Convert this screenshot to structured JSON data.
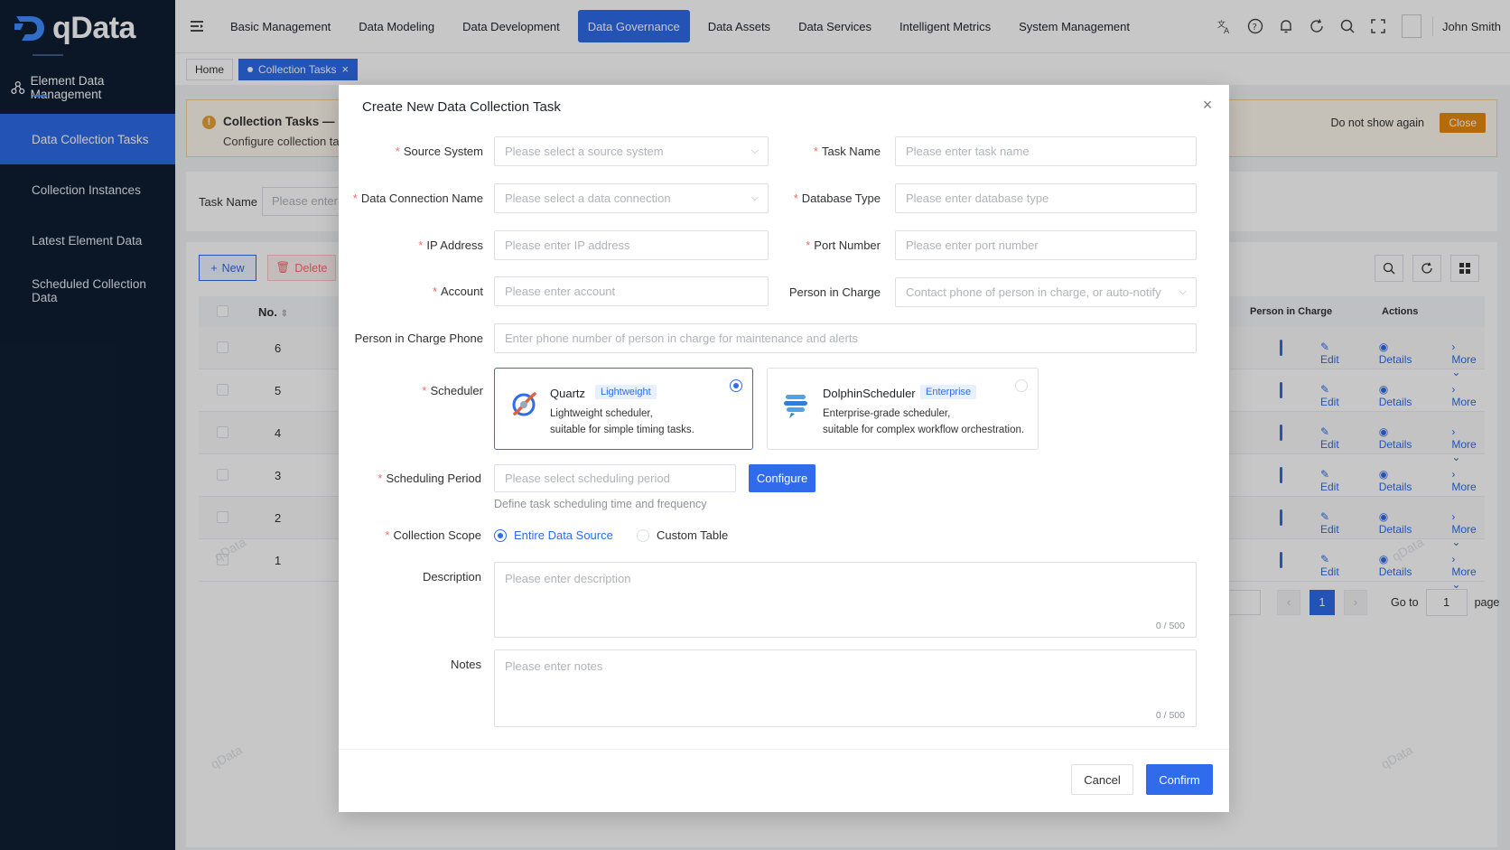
{
  "app": {
    "logo_text": "qData",
    "user_name": "John Smith",
    "watermark": "qData"
  },
  "sidebar": {
    "header": "Element Data Management",
    "items": [
      {
        "label": "Data Collection Tasks",
        "active": true
      },
      {
        "label": "Collection Instances"
      },
      {
        "label": "Latest Element Data"
      },
      {
        "label": "Scheduled Collection Data"
      }
    ]
  },
  "topnav": {
    "items": [
      {
        "label": "Basic Management"
      },
      {
        "label": "Data Modeling"
      },
      {
        "label": "Data Development"
      },
      {
        "label": "Data Governance",
        "active": true
      },
      {
        "label": "Data Assets"
      },
      {
        "label": "Data Services"
      },
      {
        "label": "Intelligent Metrics"
      },
      {
        "label": "System Management"
      }
    ],
    "icons": [
      "translate-icon",
      "help-icon",
      "bell-icon",
      "refresh-icon",
      "search-icon",
      "fullscreen-icon"
    ]
  },
  "tabs": {
    "home": "Home",
    "current": "Collection Tasks"
  },
  "alert": {
    "title": "Collection Tasks — I",
    "subtitle": "Configure collection ta",
    "no_show": "Do not show again",
    "close": "Close"
  },
  "search": {
    "task_name_label": "Task Name",
    "task_name_placeholder": "Please enter"
  },
  "table": {
    "new_label": "New",
    "delete_label": "Delete",
    "col_no": "No.",
    "col_person": "Person in Charge",
    "col_actions": "Actions",
    "rows": [
      {
        "no": "6"
      },
      {
        "no": "5"
      },
      {
        "no": "4"
      },
      {
        "no": "3"
      },
      {
        "no": "2"
      },
      {
        "no": "1"
      }
    ],
    "action_edit": "Edit",
    "action_details": "Details",
    "action_more": "More"
  },
  "pagination": {
    "current_page": "1",
    "goto_label": "Go to",
    "goto_value": "1",
    "page_label": "page"
  },
  "modal": {
    "title": "Create New Data Collection Task",
    "fields": {
      "source_system": {
        "label": "Source System",
        "placeholder": "Please select a source system"
      },
      "task_name": {
        "label": "Task Name",
        "placeholder": "Please enter task name"
      },
      "data_connection": {
        "label": "Data Connection Name",
        "placeholder": "Please select a data connection"
      },
      "database_type": {
        "label": "Database Type",
        "placeholder": "Please enter database type"
      },
      "ip_address": {
        "label": "IP Address",
        "placeholder": "Please enter IP address"
      },
      "port_number": {
        "label": "Port Number",
        "placeholder": "Please enter port number"
      },
      "account": {
        "label": "Account",
        "placeholder": "Please enter account"
      },
      "person_in_charge": {
        "label": "Person in Charge",
        "placeholder": "Contact phone of person in charge, or auto-notify"
      },
      "person_phone": {
        "label": "Person in Charge Phone",
        "placeholder": "Enter phone number of person in charge for maintenance and alerts"
      },
      "scheduler": {
        "label": "Scheduler"
      },
      "scheduling_period": {
        "label": "Scheduling Period",
        "placeholder": "Please select scheduling period",
        "button": "Configure",
        "hint": "Define task scheduling time and frequency"
      },
      "collection_scope": {
        "label": "Collection Scope",
        "option_entire": "Entire Data Source",
        "option_custom": "Custom Table",
        "selected": "Entire Data Source"
      },
      "description": {
        "label": "Description",
        "placeholder": "Please enter description",
        "counter": "0 / 500"
      },
      "notes": {
        "label": "Notes",
        "placeholder": "Please enter notes",
        "counter": "0 / 500"
      }
    },
    "schedulers": [
      {
        "name": "Quartz",
        "badge": "Lightweight",
        "desc1": "Lightweight scheduler,",
        "desc2": "suitable for simple timing tasks.",
        "selected": true
      },
      {
        "name": "DolphinScheduler",
        "badge": "Enterprise",
        "desc1": "Enterprise-grade scheduler,",
        "desc2": "suitable for complex workflow orchestration.",
        "selected": false
      }
    ],
    "cancel": "Cancel",
    "confirm": "Confirm"
  },
  "colors": {
    "primary": "#2f6bea",
    "sidebar_bg": "#0f1e33",
    "warning": "#e6890f",
    "danger": "#f56c6c"
  }
}
